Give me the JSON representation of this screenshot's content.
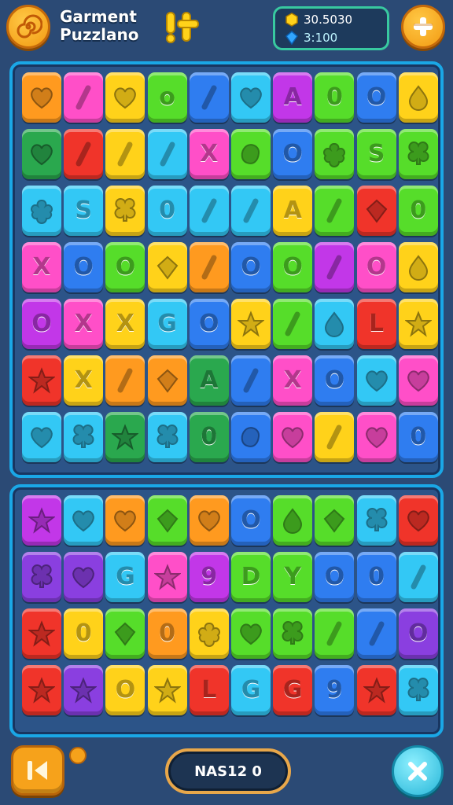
{
  "header": {
    "title_line1": "Garment",
    "title_line2": "Puzzlano",
    "coins": "30.5030",
    "gems": "3:100",
    "swirl_icon": "swirl-icon",
    "settings_icon": "plus-icon"
  },
  "footer": {
    "score_label": "NAS12 0",
    "back_icon": "back-icon",
    "close_icon": "close-icon"
  },
  "palette": {
    "orange": "#ff9a1f",
    "pink": "#ff4fc8",
    "yellow": "#ffd21a",
    "green": "#56dd2a",
    "blue": "#2f7df0",
    "cyan": "#33c8f5",
    "magenta": "#c237e8",
    "red": "#f0342a",
    "darkgreen": "#2aa84e",
    "purple": "#8a3fe0"
  },
  "board_top": [
    [
      [
        "orange",
        "heart"
      ],
      [
        "pink",
        "slash"
      ],
      [
        "yellow",
        "heart"
      ],
      [
        "green",
        "o"
      ],
      [
        "blue",
        "slash"
      ],
      [
        "cyan",
        "heart"
      ],
      [
        "magenta",
        "A"
      ],
      [
        "green",
        "0"
      ],
      [
        "blue",
        "O"
      ],
      [
        "yellow",
        "drop"
      ]
    ],
    [
      [
        "darkgreen",
        "heart"
      ],
      [
        "red",
        "slash"
      ],
      [
        "yellow",
        "slash"
      ],
      [
        "cyan",
        "slash"
      ],
      [
        "pink",
        "X"
      ],
      [
        "green",
        "blob"
      ],
      [
        "blue",
        "O"
      ],
      [
        "green",
        "flower"
      ],
      [
        "green",
        "S"
      ],
      [
        "green",
        "clover"
      ]
    ],
    [
      [
        "cyan",
        "flower"
      ],
      [
        "cyan",
        "S"
      ],
      [
        "yellow",
        "clover"
      ],
      [
        "cyan",
        "0"
      ],
      [
        "cyan",
        "slash"
      ],
      [
        "cyan",
        "slash"
      ],
      [
        "yellow",
        "A"
      ],
      [
        "green",
        "slash"
      ],
      [
        "red",
        "diamond"
      ],
      [
        "green",
        "0"
      ]
    ],
    [
      [
        "pink",
        "X"
      ],
      [
        "blue",
        "O"
      ],
      [
        "green",
        "O"
      ],
      [
        "yellow",
        "diamond"
      ],
      [
        "orange",
        "slash"
      ],
      [
        "blue",
        "O"
      ],
      [
        "green",
        "O"
      ],
      [
        "magenta",
        "slash"
      ],
      [
        "pink",
        "O"
      ],
      [
        "yellow",
        "drop"
      ]
    ],
    [
      [
        "magenta",
        "O"
      ],
      [
        "pink",
        "X"
      ],
      [
        "yellow",
        "X"
      ],
      [
        "cyan",
        "G"
      ],
      [
        "blue",
        "O"
      ],
      [
        "yellow",
        "star"
      ],
      [
        "green",
        "slash"
      ],
      [
        "cyan",
        "drop"
      ],
      [
        "red",
        "L"
      ],
      [
        "yellow",
        "star"
      ]
    ],
    [
      [
        "red",
        "star"
      ],
      [
        "yellow",
        "X"
      ],
      [
        "orange",
        "slash"
      ],
      [
        "orange",
        "diamond"
      ],
      [
        "darkgreen",
        "A"
      ],
      [
        "blue",
        "slash"
      ],
      [
        "pink",
        "X"
      ],
      [
        "blue",
        "O"
      ],
      [
        "cyan",
        "heart"
      ],
      [
        "pink",
        "heart"
      ]
    ],
    [
      [
        "cyan",
        "heart"
      ],
      [
        "cyan",
        "clover"
      ],
      [
        "darkgreen",
        "star"
      ],
      [
        "cyan",
        "clover"
      ],
      [
        "darkgreen",
        "0"
      ],
      [
        "blue",
        "blob"
      ],
      [
        "pink",
        "heart"
      ],
      [
        "yellow",
        "slash"
      ],
      [
        "pink",
        "heart"
      ],
      [
        "blue",
        "0"
      ]
    ]
  ],
  "board_bottom": [
    [
      [
        "magenta",
        "star"
      ],
      [
        "cyan",
        "heart"
      ],
      [
        "orange",
        "heart"
      ],
      [
        "green",
        "diamond"
      ],
      [
        "orange",
        "heart"
      ],
      [
        "blue",
        "O"
      ],
      [
        "green",
        "drop"
      ],
      [
        "green",
        "diamond"
      ],
      [
        "cyan",
        "clover"
      ],
      [
        "red",
        "heart"
      ]
    ],
    [
      [
        "purple",
        "clover"
      ],
      [
        "purple",
        "heart"
      ],
      [
        "cyan",
        "G"
      ],
      [
        "pink",
        "star"
      ],
      [
        "magenta",
        "9"
      ],
      [
        "green",
        "D"
      ],
      [
        "green",
        "Y"
      ],
      [
        "blue",
        "O"
      ],
      [
        "blue",
        "0"
      ],
      [
        "cyan",
        "slash"
      ]
    ],
    [
      [
        "red",
        "star"
      ],
      [
        "yellow",
        "0"
      ],
      [
        "green",
        "diamond"
      ],
      [
        "orange",
        "0"
      ],
      [
        "yellow",
        "flower"
      ],
      [
        "green",
        "heart"
      ],
      [
        "green",
        "clover"
      ],
      [
        "green",
        "slash"
      ],
      [
        "blue",
        "slash"
      ],
      [
        "purple",
        "O"
      ]
    ],
    [
      [
        "red",
        "star"
      ],
      [
        "purple",
        "star"
      ],
      [
        "yellow",
        "O"
      ],
      [
        "yellow",
        "star"
      ],
      [
        "red",
        "L"
      ],
      [
        "cyan",
        "G"
      ],
      [
        "red",
        "G"
      ],
      [
        "blue",
        "9"
      ],
      [
        "red",
        "star"
      ],
      [
        "cyan",
        "clover"
      ]
    ]
  ]
}
